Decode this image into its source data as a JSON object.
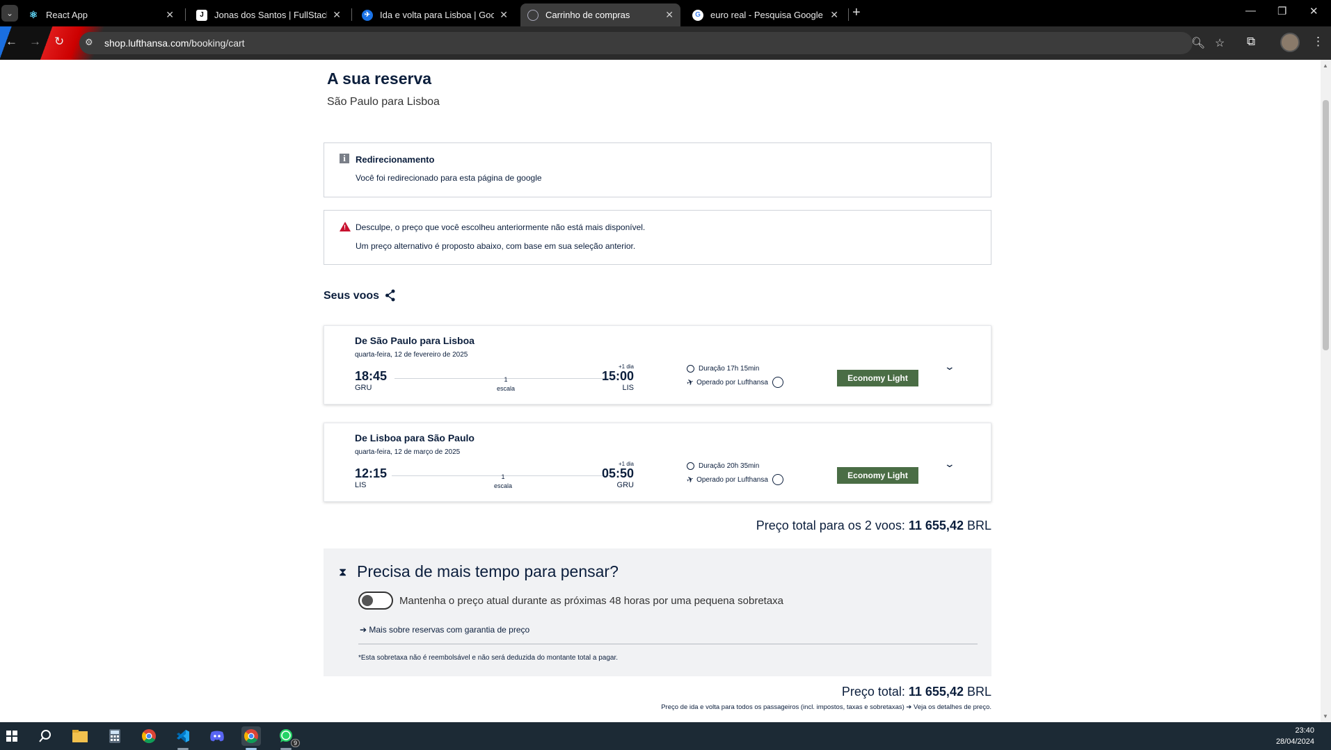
{
  "browser": {
    "tabs": [
      {
        "title": "React App",
        "active": false
      },
      {
        "title": "Jonas dos Santos | FullStack De",
        "active": false
      },
      {
        "title": "Ida e volta para Lisboa | Google",
        "active": false
      },
      {
        "title": "Carrinho de compras",
        "active": true
      },
      {
        "title": "euro real - Pesquisa Google",
        "active": false
      }
    ],
    "url_host": "shop.lufthansa.com",
    "url_path": "/booking/cart"
  },
  "page": {
    "title": "A sua reserva",
    "subtitle": "São Paulo para Lisboa",
    "redirect_notice": {
      "title": "Redirecionamento",
      "text": "Você foi redirecionado para esta página de google"
    },
    "price_notice": {
      "line1": "Desculpe, o preço que você escolheu anteriormente não está mais disponível.",
      "line2": "Um preço alternativo é proposto abaixo, com base em sua seleção anterior."
    },
    "flights_title": "Seus voos",
    "flights": [
      {
        "route": "De São Paulo para Lisboa",
        "date": "quarta-feira, 12 de fevereiro de 2025",
        "dep_time": "18:45",
        "dep_code": "GRU",
        "stops_num": "1",
        "stops_label": "escala",
        "day_offset": "+1 dia",
        "arr_time": "15:00",
        "arr_code": "LIS",
        "duration": "Duração 17h 15min",
        "operated": "Operado por Lufthansa",
        "fare": "Economy Light"
      },
      {
        "route": "De Lisboa para São Paulo",
        "date": "quarta-feira, 12 de março de 2025",
        "dep_time": "12:15",
        "dep_code": "LIS",
        "stops_num": "1",
        "stops_label": "escala",
        "day_offset": "+1 dia",
        "arr_time": "05:50",
        "arr_code": "GRU",
        "duration": "Duração 20h 35min",
        "operated": "Operado por Lufthansa",
        "fare": "Economy Light"
      }
    ],
    "total_flights_label": "Preço total para os 2 voos:",
    "total_flights_amount": "11 655,42",
    "currency": "BRL",
    "hold": {
      "title": "Precisa de mais tempo para pensar?",
      "toggle_label": "Mantenha o preço atual durante as próximas 48 horas por uma pequena sobretaxa",
      "toggle_on": false,
      "more_link": "Mais sobre reservas com garantia de preço",
      "fine_print": "*Esta sobretaxa não é reembolsável e não será deduzida do montante total a pagar."
    },
    "total_label": "Preço total:",
    "total_amount": "11 655,42",
    "total_note": "Preço de ida e volta para todos os passageiros (incl. impostos, taxas e sobretaxas)",
    "price_details_link": "Veja os detalhes de preço."
  },
  "taskbar": {
    "time": "23:40",
    "date": "28/04/2024",
    "whatsapp_badge": "9"
  },
  "colors": {
    "brand_navy": "#0b1e3c",
    "fare_green": "#4a6d45",
    "warning_red": "#c8102e"
  }
}
